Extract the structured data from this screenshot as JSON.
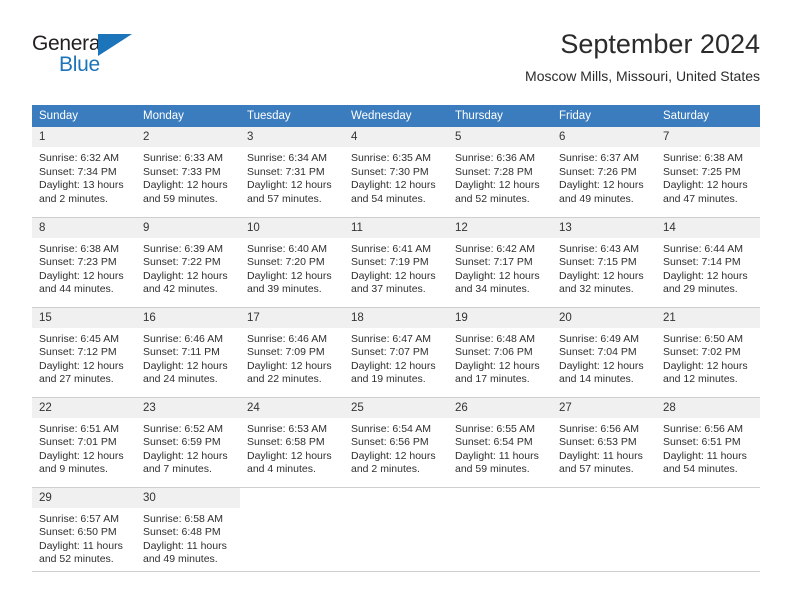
{
  "brand": {
    "name_top": "General",
    "name_bottom": "Blue",
    "accent_color": "#1c74bb",
    "triangle_icon": "brand-triangle-icon"
  },
  "header": {
    "title": "September 2024",
    "subtitle": "Moscow Mills, Missouri, United States"
  },
  "calendar": {
    "header_bg": "#3a7cbe",
    "daynum_bg": "#f0f0f0",
    "weekdays": [
      "Sunday",
      "Monday",
      "Tuesday",
      "Wednesday",
      "Thursday",
      "Friday",
      "Saturday"
    ],
    "weeks": [
      [
        {
          "day": "1",
          "sunrise": "Sunrise: 6:32 AM",
          "sunset": "Sunset: 7:34 PM",
          "daylight_1": "Daylight: 13 hours",
          "daylight_2": "and 2 minutes."
        },
        {
          "day": "2",
          "sunrise": "Sunrise: 6:33 AM",
          "sunset": "Sunset: 7:33 PM",
          "daylight_1": "Daylight: 12 hours",
          "daylight_2": "and 59 minutes."
        },
        {
          "day": "3",
          "sunrise": "Sunrise: 6:34 AM",
          "sunset": "Sunset: 7:31 PM",
          "daylight_1": "Daylight: 12 hours",
          "daylight_2": "and 57 minutes."
        },
        {
          "day": "4",
          "sunrise": "Sunrise: 6:35 AM",
          "sunset": "Sunset: 7:30 PM",
          "daylight_1": "Daylight: 12 hours",
          "daylight_2": "and 54 minutes."
        },
        {
          "day": "5",
          "sunrise": "Sunrise: 6:36 AM",
          "sunset": "Sunset: 7:28 PM",
          "daylight_1": "Daylight: 12 hours",
          "daylight_2": "and 52 minutes."
        },
        {
          "day": "6",
          "sunrise": "Sunrise: 6:37 AM",
          "sunset": "Sunset: 7:26 PM",
          "daylight_1": "Daylight: 12 hours",
          "daylight_2": "and 49 minutes."
        },
        {
          "day": "7",
          "sunrise": "Sunrise: 6:38 AM",
          "sunset": "Sunset: 7:25 PM",
          "daylight_1": "Daylight: 12 hours",
          "daylight_2": "and 47 minutes."
        }
      ],
      [
        {
          "day": "8",
          "sunrise": "Sunrise: 6:38 AM",
          "sunset": "Sunset: 7:23 PM",
          "daylight_1": "Daylight: 12 hours",
          "daylight_2": "and 44 minutes."
        },
        {
          "day": "9",
          "sunrise": "Sunrise: 6:39 AM",
          "sunset": "Sunset: 7:22 PM",
          "daylight_1": "Daylight: 12 hours",
          "daylight_2": "and 42 minutes."
        },
        {
          "day": "10",
          "sunrise": "Sunrise: 6:40 AM",
          "sunset": "Sunset: 7:20 PM",
          "daylight_1": "Daylight: 12 hours",
          "daylight_2": "and 39 minutes."
        },
        {
          "day": "11",
          "sunrise": "Sunrise: 6:41 AM",
          "sunset": "Sunset: 7:19 PM",
          "daylight_1": "Daylight: 12 hours",
          "daylight_2": "and 37 minutes."
        },
        {
          "day": "12",
          "sunrise": "Sunrise: 6:42 AM",
          "sunset": "Sunset: 7:17 PM",
          "daylight_1": "Daylight: 12 hours",
          "daylight_2": "and 34 minutes."
        },
        {
          "day": "13",
          "sunrise": "Sunrise: 6:43 AM",
          "sunset": "Sunset: 7:15 PM",
          "daylight_1": "Daylight: 12 hours",
          "daylight_2": "and 32 minutes."
        },
        {
          "day": "14",
          "sunrise": "Sunrise: 6:44 AM",
          "sunset": "Sunset: 7:14 PM",
          "daylight_1": "Daylight: 12 hours",
          "daylight_2": "and 29 minutes."
        }
      ],
      [
        {
          "day": "15",
          "sunrise": "Sunrise: 6:45 AM",
          "sunset": "Sunset: 7:12 PM",
          "daylight_1": "Daylight: 12 hours",
          "daylight_2": "and 27 minutes."
        },
        {
          "day": "16",
          "sunrise": "Sunrise: 6:46 AM",
          "sunset": "Sunset: 7:11 PM",
          "daylight_1": "Daylight: 12 hours",
          "daylight_2": "and 24 minutes."
        },
        {
          "day": "17",
          "sunrise": "Sunrise: 6:46 AM",
          "sunset": "Sunset: 7:09 PM",
          "daylight_1": "Daylight: 12 hours",
          "daylight_2": "and 22 minutes."
        },
        {
          "day": "18",
          "sunrise": "Sunrise: 6:47 AM",
          "sunset": "Sunset: 7:07 PM",
          "daylight_1": "Daylight: 12 hours",
          "daylight_2": "and 19 minutes."
        },
        {
          "day": "19",
          "sunrise": "Sunrise: 6:48 AM",
          "sunset": "Sunset: 7:06 PM",
          "daylight_1": "Daylight: 12 hours",
          "daylight_2": "and 17 minutes."
        },
        {
          "day": "20",
          "sunrise": "Sunrise: 6:49 AM",
          "sunset": "Sunset: 7:04 PM",
          "daylight_1": "Daylight: 12 hours",
          "daylight_2": "and 14 minutes."
        },
        {
          "day": "21",
          "sunrise": "Sunrise: 6:50 AM",
          "sunset": "Sunset: 7:02 PM",
          "daylight_1": "Daylight: 12 hours",
          "daylight_2": "and 12 minutes."
        }
      ],
      [
        {
          "day": "22",
          "sunrise": "Sunrise: 6:51 AM",
          "sunset": "Sunset: 7:01 PM",
          "daylight_1": "Daylight: 12 hours",
          "daylight_2": "and 9 minutes."
        },
        {
          "day": "23",
          "sunrise": "Sunrise: 6:52 AM",
          "sunset": "Sunset: 6:59 PM",
          "daylight_1": "Daylight: 12 hours",
          "daylight_2": "and 7 minutes."
        },
        {
          "day": "24",
          "sunrise": "Sunrise: 6:53 AM",
          "sunset": "Sunset: 6:58 PM",
          "daylight_1": "Daylight: 12 hours",
          "daylight_2": "and 4 minutes."
        },
        {
          "day": "25",
          "sunrise": "Sunrise: 6:54 AM",
          "sunset": "Sunset: 6:56 PM",
          "daylight_1": "Daylight: 12 hours",
          "daylight_2": "and 2 minutes."
        },
        {
          "day": "26",
          "sunrise": "Sunrise: 6:55 AM",
          "sunset": "Sunset: 6:54 PM",
          "daylight_1": "Daylight: 11 hours",
          "daylight_2": "and 59 minutes."
        },
        {
          "day": "27",
          "sunrise": "Sunrise: 6:56 AM",
          "sunset": "Sunset: 6:53 PM",
          "daylight_1": "Daylight: 11 hours",
          "daylight_2": "and 57 minutes."
        },
        {
          "day": "28",
          "sunrise": "Sunrise: 6:56 AM",
          "sunset": "Sunset: 6:51 PM",
          "daylight_1": "Daylight: 11 hours",
          "daylight_2": "and 54 minutes."
        }
      ],
      [
        {
          "day": "29",
          "sunrise": "Sunrise: 6:57 AM",
          "sunset": "Sunset: 6:50 PM",
          "daylight_1": "Daylight: 11 hours",
          "daylight_2": "and 52 minutes."
        },
        {
          "day": "30",
          "sunrise": "Sunrise: 6:58 AM",
          "sunset": "Sunset: 6:48 PM",
          "daylight_1": "Daylight: 11 hours",
          "daylight_2": "and 49 minutes."
        },
        {
          "day": "",
          "sunrise": "",
          "sunset": "",
          "daylight_1": "",
          "daylight_2": ""
        },
        {
          "day": "",
          "sunrise": "",
          "sunset": "",
          "daylight_1": "",
          "daylight_2": ""
        },
        {
          "day": "",
          "sunrise": "",
          "sunset": "",
          "daylight_1": "",
          "daylight_2": ""
        },
        {
          "day": "",
          "sunrise": "",
          "sunset": "",
          "daylight_1": "",
          "daylight_2": ""
        },
        {
          "day": "",
          "sunrise": "",
          "sunset": "",
          "daylight_1": "",
          "daylight_2": ""
        }
      ]
    ]
  }
}
